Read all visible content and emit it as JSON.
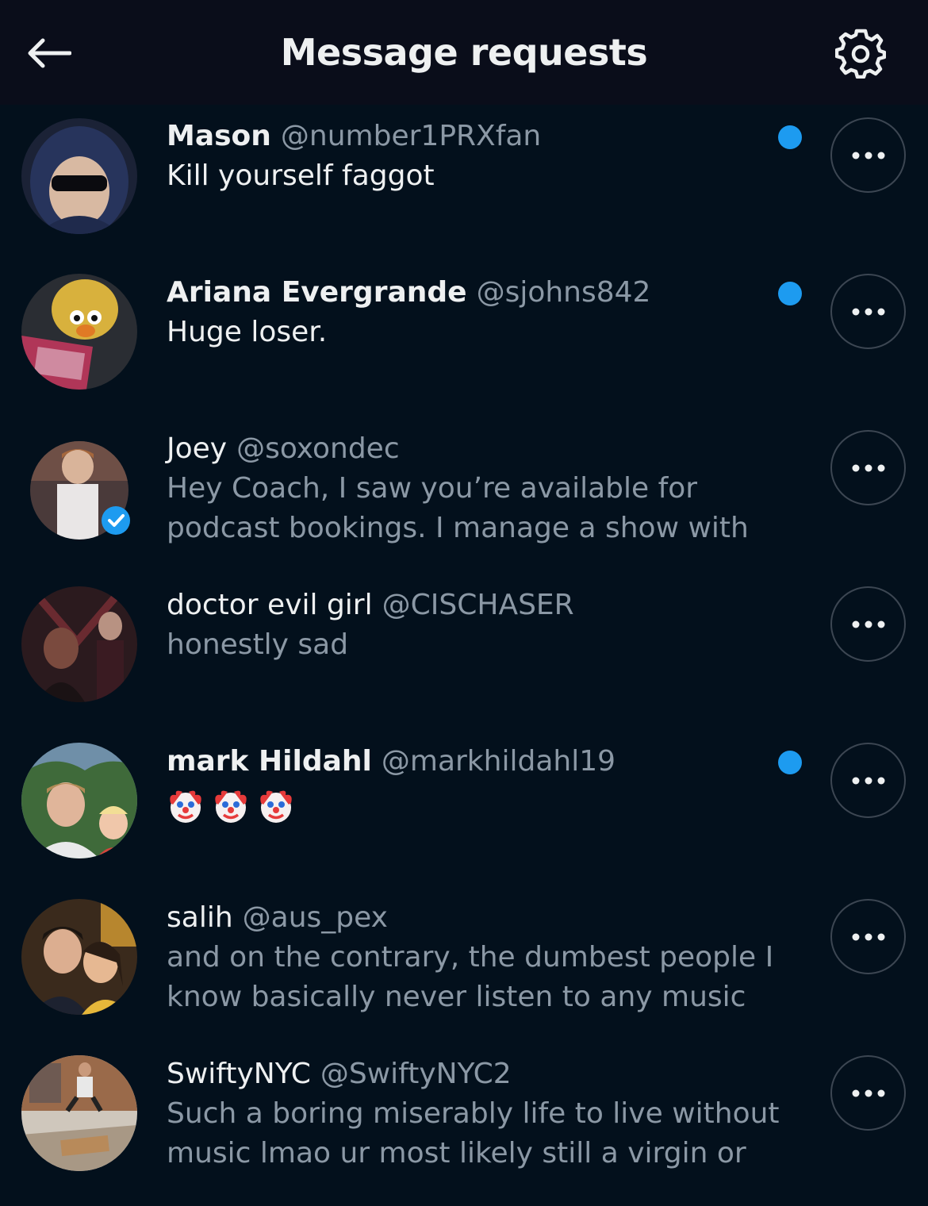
{
  "header": {
    "title": "Message requests",
    "back_icon": "arrow-left-icon",
    "settings_icon": "gear-icon"
  },
  "colors": {
    "background": "#03101c",
    "header_bg": "#0a0d1a",
    "accent": "#1d9bf0",
    "muted_text": "#8b98a5"
  },
  "requests": [
    {
      "name": "Mason",
      "handle": "@number1PRXfan",
      "message_lines": [
        "Kill yourself faggot"
      ],
      "unread": true,
      "verified": false
    },
    {
      "name": "Ariana Evergrande",
      "handle": "@sjohns842",
      "message_lines": [
        "Huge loser."
      ],
      "unread": true,
      "verified": false
    },
    {
      "name": "Joey",
      "handle": "@soxondec",
      "message_lines": [
        "Hey Coach, I saw you’re available for",
        "podcast bookings. I manage a show with"
      ],
      "unread": false,
      "verified": true
    },
    {
      "name": "doctor evil girl",
      "handle": "@CISCHASER",
      "message_lines": [
        "honestly sad"
      ],
      "unread": false,
      "verified": false
    },
    {
      "name": "mark Hildahl",
      "handle": "@markhildahl19",
      "message_lines": [
        "🤡🤡🤡"
      ],
      "unread": true,
      "verified": false
    },
    {
      "name": "salih",
      "handle": "@aus_pex",
      "message_lines": [
        "and on the contrary, the dumbest people I",
        "know basically never listen to any music"
      ],
      "unread": false,
      "verified": false
    },
    {
      "name": "SwiftyNYC",
      "handle": "@SwiftyNYC2",
      "message_lines": [
        "Such a boring miserably life to live without",
        "music lmao ur most likely still a virgin or"
      ],
      "unread": false,
      "verified": false
    }
  ]
}
